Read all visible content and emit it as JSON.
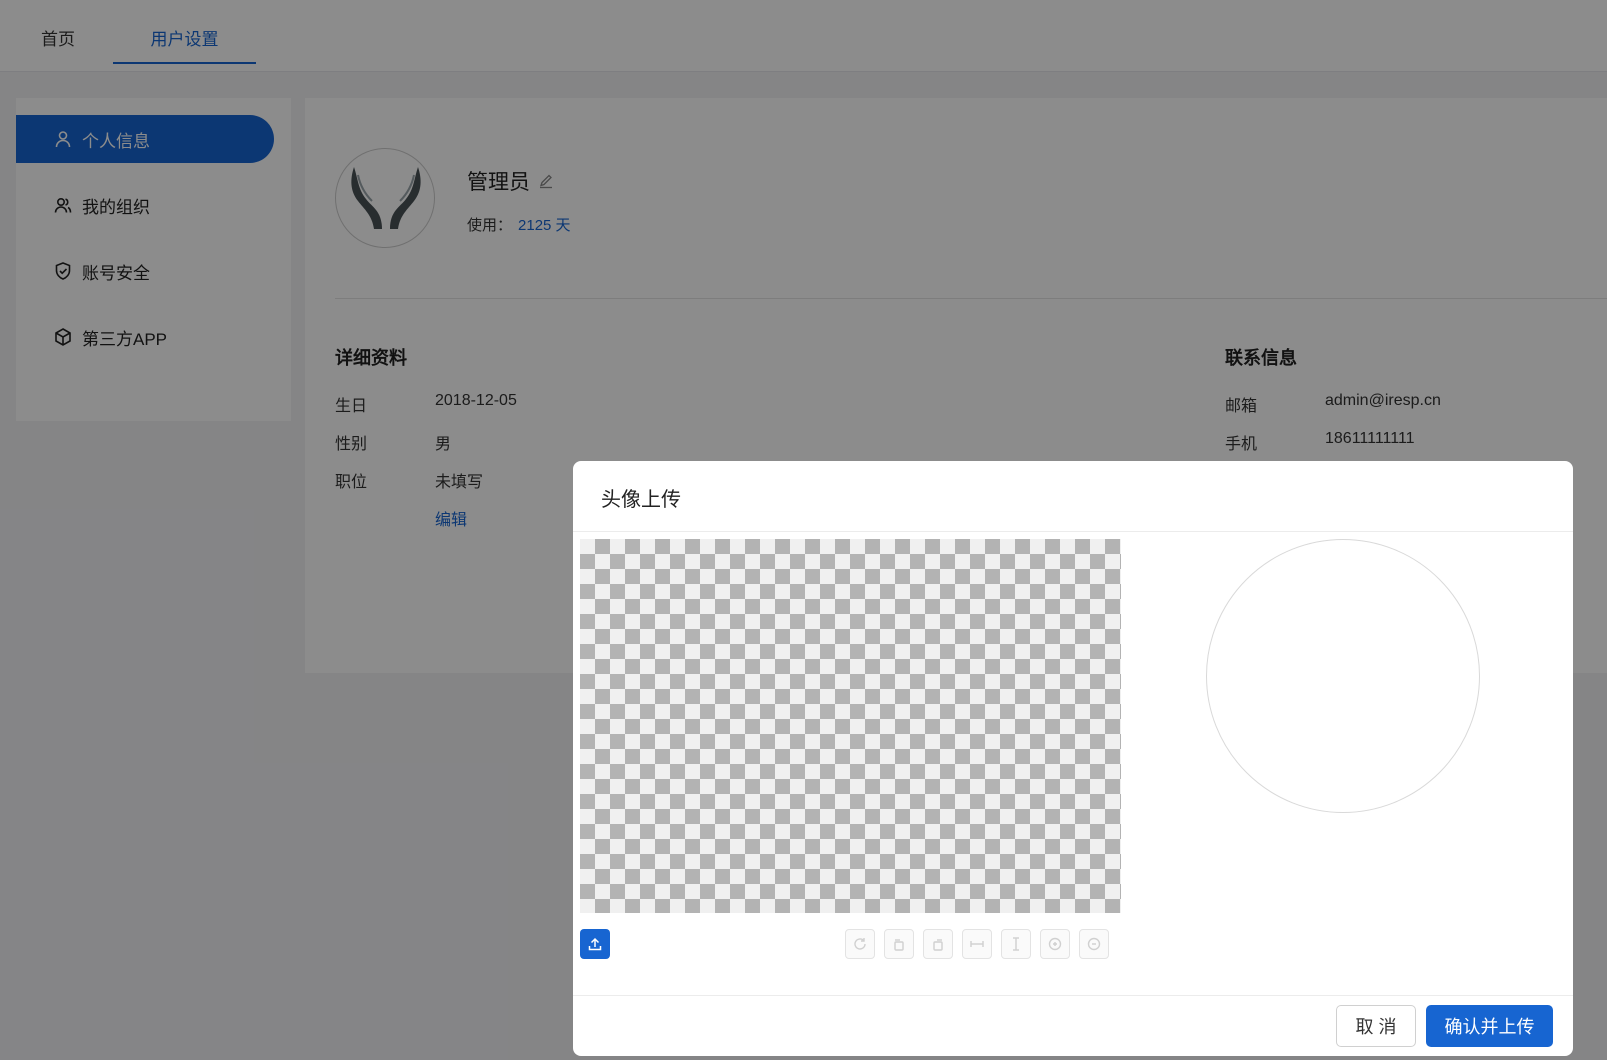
{
  "header": {
    "tabs": [
      {
        "label": "首页"
      },
      {
        "label": "用户设置"
      }
    ]
  },
  "sidebar": {
    "items": [
      {
        "label": "个人信息",
        "icon": "user-icon",
        "active": true
      },
      {
        "label": "我的组织",
        "icon": "users-icon"
      },
      {
        "label": "账号安全",
        "icon": "shield-icon"
      },
      {
        "label": "第三方APP",
        "icon": "cube-icon"
      }
    ]
  },
  "profile": {
    "name": "管理员",
    "usage_label": "使用：",
    "usage_value": "2125 天"
  },
  "details": {
    "title": "详细资料",
    "rows": [
      {
        "label": "生日",
        "value": "2018-12-05"
      },
      {
        "label": "性别",
        "value": "男"
      },
      {
        "label": "职位",
        "value": "未填写"
      }
    ],
    "edit_link": "编辑"
  },
  "contact": {
    "title": "联系信息",
    "rows": [
      {
        "label": "邮箱",
        "value": "admin@iresp.cn"
      },
      {
        "label": "手机",
        "value": "18611111111"
      }
    ]
  },
  "modal": {
    "title": "头像上传",
    "cancel_label": "取 消",
    "confirm_label": "确认并上传",
    "tools": [
      "rotate-icon",
      "rotate-left-icon",
      "rotate-right-icon",
      "flip-horizontal-icon",
      "flip-vertical-icon",
      "zoom-in-icon",
      "zoom-out-icon"
    ]
  },
  "colors": {
    "accent": "#1765d1",
    "mask": "rgba(0,0,0,0.45)"
  }
}
